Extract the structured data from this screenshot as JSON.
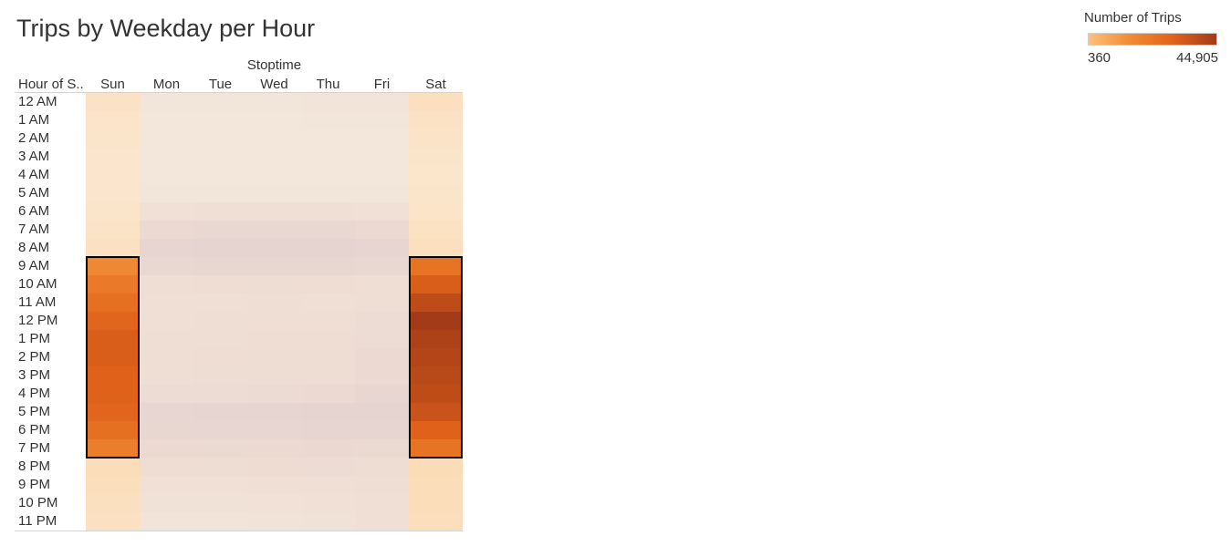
{
  "title": "Trips by Weekday per Hour",
  "legend": {
    "title": "Number of Trips",
    "min_label": "360",
    "max_label": "44,905",
    "min": 360,
    "max": 44905
  },
  "chart_data": {
    "type": "heatmap",
    "title": "Trips by Weekday per Hour",
    "column_header": "Stoptime",
    "row_header": "Hour of S..",
    "columns": [
      "Sun",
      "Mon",
      "Tue",
      "Wed",
      "Thu",
      "Fri",
      "Sat"
    ],
    "rows": [
      "12 AM",
      "1 AM",
      "2 AM",
      "3 AM",
      "4 AM",
      "5 AM",
      "6 AM",
      "7 AM",
      "8 AM",
      "9 AM",
      "10 AM",
      "11 AM",
      "12 PM",
      "1 PM",
      "2 PM",
      "3 PM",
      "4 PM",
      "5 PM",
      "6 PM",
      "7 PM",
      "8 PM",
      "9 PM",
      "10 PM",
      "11 PM"
    ],
    "values": [
      [
        1800,
        1100,
        1100,
        1200,
        1300,
        1500,
        2600
      ],
      [
        1300,
        800,
        800,
        800,
        900,
        1000,
        1800
      ],
      [
        1000,
        550,
        550,
        600,
        600,
        700,
        1400
      ],
      [
        800,
        400,
        400,
        400,
        450,
        500,
        1000
      ],
      [
        600,
        360,
        380,
        380,
        400,
        450,
        800
      ],
      [
        800,
        900,
        950,
        950,
        950,
        900,
        1000
      ],
      [
        1000,
        3000,
        3300,
        3400,
        3300,
        3000,
        1300
      ],
      [
        1500,
        5500,
        6000,
        6100,
        6000,
        5500,
        1900
      ],
      [
        2200,
        7500,
        8200,
        8300,
        8400,
        7500,
        2600
      ],
      [
        23000,
        6000,
        6500,
        6600,
        6500,
        6000,
        29000
      ],
      [
        27000,
        3500,
        3800,
        3900,
        3800,
        3600,
        35000
      ],
      [
        30000,
        3200,
        3400,
        3500,
        3400,
        3700,
        40000
      ],
      [
        33000,
        3400,
        3600,
        3700,
        3600,
        4300,
        44905
      ],
      [
        35000,
        3500,
        3700,
        3800,
        3800,
        4500,
        43000
      ],
      [
        35000,
        3600,
        3800,
        3900,
        3900,
        4900,
        42000
      ],
      [
        34000,
        3700,
        3900,
        4000,
        4100,
        5400,
        41000
      ],
      [
        34000,
        4300,
        4500,
        4700,
        5000,
        6500,
        40000
      ],
      [
        33000,
        7000,
        7300,
        7500,
        8000,
        8200,
        38000
      ],
      [
        30000,
        6700,
        7000,
        7200,
        7600,
        7400,
        34000
      ],
      [
        26000,
        5000,
        5200,
        5400,
        5700,
        5200,
        29000
      ],
      [
        3300,
        3800,
        4000,
        4200,
        4500,
        4000,
        3500
      ],
      [
        2700,
        2800,
        3000,
        3200,
        3400,
        3500,
        3300
      ],
      [
        2300,
        2000,
        2200,
        2400,
        2800,
        3300,
        3200
      ],
      [
        2000,
        1400,
        1600,
        1700,
        2100,
        3200,
        3000
      ]
    ],
    "highlight_ranges": [
      {
        "column": "Sun",
        "from": "9 AM",
        "to": "7 PM"
      },
      {
        "column": "Sat",
        "from": "9 AM",
        "to": "7 PM"
      }
    ],
    "colors": {
      "weekday_palette": [
        "#f3e7db",
        "#f0dfd4",
        "#e9d7d1",
        "#e4d3d0"
      ],
      "weekend_palette": [
        "#fbe7cf",
        "#fdc07a",
        "#f08a32",
        "#e0621a",
        "#a33b19"
      ],
      "highlight_border": "#000000"
    }
  }
}
